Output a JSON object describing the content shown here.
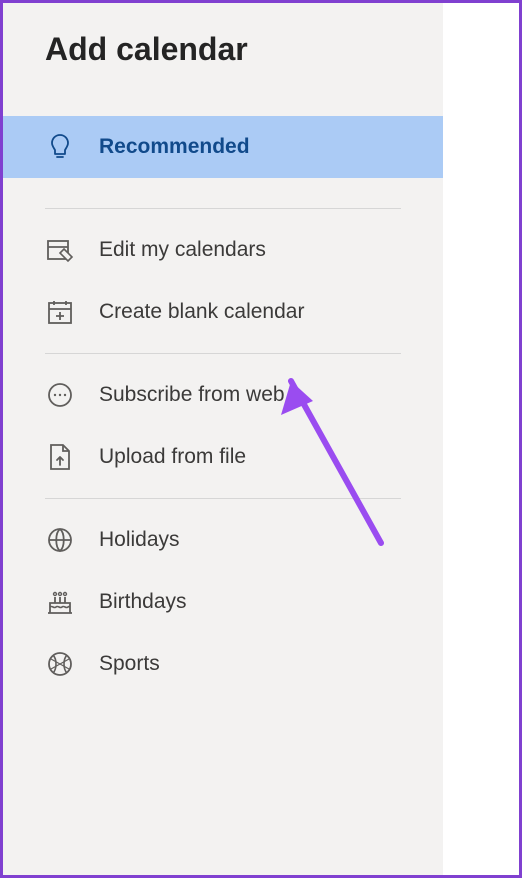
{
  "title": "Add calendar",
  "menu": {
    "recommended": "Recommended",
    "edit_calendars": "Edit my calendars",
    "create_blank": "Create blank calendar",
    "subscribe_web": "Subscribe from web",
    "upload_file": "Upload from file",
    "holidays": "Holidays",
    "birthdays": "Birthdays",
    "sports": "Sports"
  }
}
